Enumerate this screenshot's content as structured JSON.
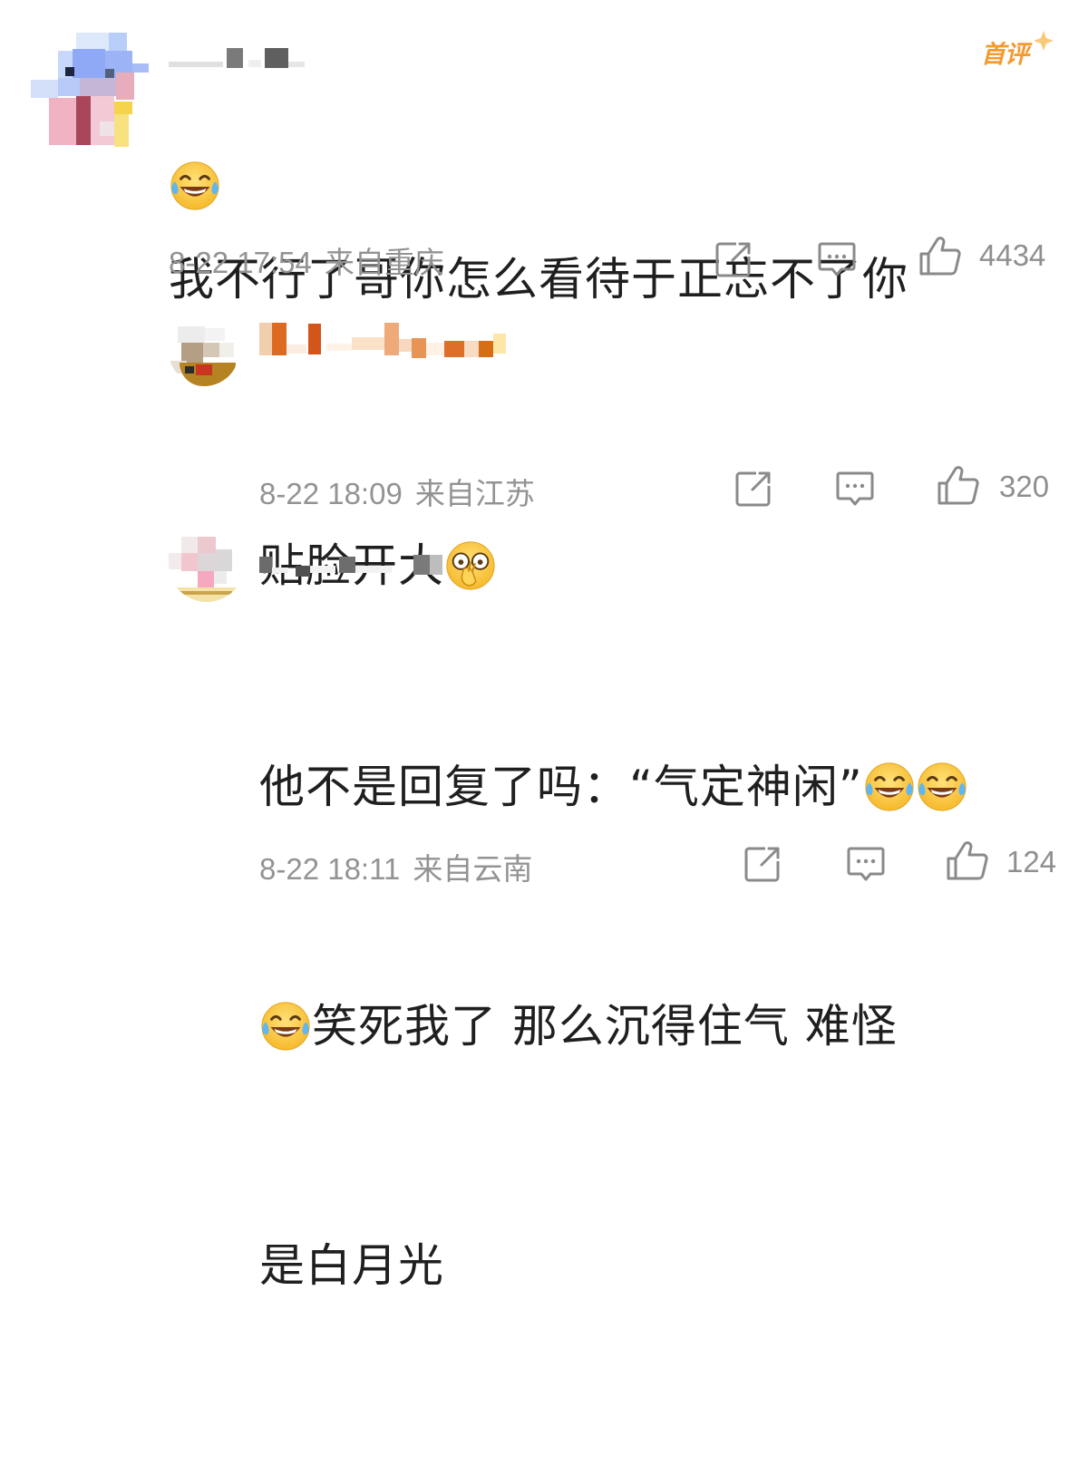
{
  "comments": [
    {
      "text_lines": [
        "我不行了哥你怎么看待于正忘不了你",
        ""
      ],
      "emojis_after": [
        "laugh-cry-emoji"
      ],
      "date": "8-22 17:54",
      "location": "来自重庆",
      "likes": "4434",
      "badge": "首评"
    },
    {
      "text_lines": [
        "贴脸开大"
      ],
      "emojis_after": [
        "cover-face-emoji"
      ],
      "date": "8-22 18:09",
      "location": "来自江苏",
      "likes": "320"
    },
    {
      "text_lines": [
        "他不是回复了吗：“气定神闲”",
        "笑死我了 那么沉得住气  难怪",
        "是白月光"
      ],
      "emojis_after": [
        "laugh-cry-emoji",
        "laugh-cry-emoji",
        "laugh-cry-emoji"
      ],
      "date": "8-22 18:11",
      "location": "来自云南",
      "likes": "124"
    }
  ],
  "icons": {
    "repost": "repost-icon",
    "comment": "comment-icon",
    "like": "like-icon"
  },
  "colors": {
    "text": "#1f1f1f",
    "meta": "#939393",
    "icon": "#8a8a8a",
    "badge": "#f39a2e"
  }
}
